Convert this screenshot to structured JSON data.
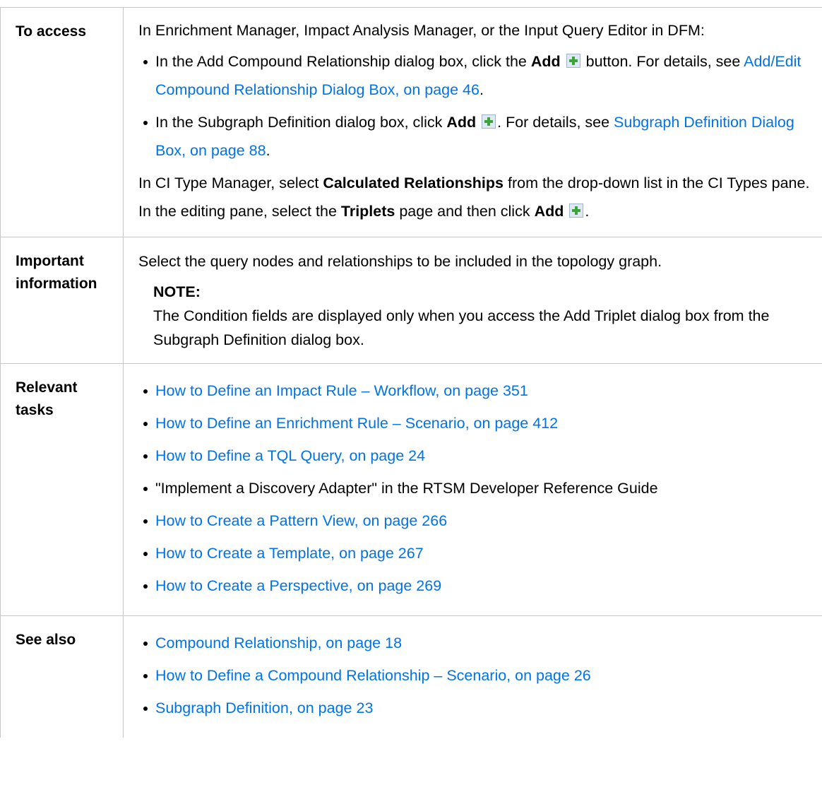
{
  "rows": {
    "access": {
      "label": "To access",
      "intro": "In Enrichment Manager, Impact Analysis Manager, or the Input Query Editor in DFM:",
      "bullet1": {
        "pre": "In the Add Compound Relationship dialog box, click the ",
        "bold": "Add",
        "mid": " button. For details, see ",
        "link": "Add/Edit Compound Relationship Dialog Box, on page 46",
        "post": "."
      },
      "bullet2": {
        "pre": "In the Subgraph Definition dialog box, click ",
        "bold": "Add",
        "mid": ". For details, see ",
        "link": "Subgraph Definition Dialog Box, on page 88",
        "post": "."
      },
      "closing": {
        "pre": "In CI Type Manager, select ",
        "bold1": "Calculated Relationships",
        "mid1": " from the drop-down list in the CI Types pane. In the editing pane, select the ",
        "bold2": "Triplets",
        "mid2": " page and then click ",
        "bold3": "Add",
        "post": "."
      }
    },
    "important": {
      "label": "Important information",
      "text": "Select the query nodes and relationships to be included in the topology graph.",
      "note_title": "NOTE:",
      "note_text": "The Condition fields are displayed only when you access the Add Triplet dialog box from the Subgraph Definition dialog box."
    },
    "relevant": {
      "label": "Relevant tasks",
      "items": [
        "How to Define an Impact Rule – Workflow, on page 351",
        "How to Define an Enrichment Rule – Scenario, on page 412",
        "How to Define a TQL Query, on page 24",
        "\"Implement a Discovery Adapter\" in the RTSM Developer Reference Guide",
        "How to Create a Pattern View, on page 266",
        "How to Create a Template, on page 267",
        "How to Create a Perspective, on page 269"
      ]
    },
    "see_also": {
      "label": "See also",
      "items": [
        "Compound Relationship, on page 18",
        "How to Define a Compound Relationship – Scenario, on page 26",
        "Subgraph Definition, on page 23"
      ]
    }
  },
  "icons": {
    "add": "add-plus-icon"
  },
  "colors": {
    "link": "#0073e7",
    "border": "#c6c6c6",
    "icon_green": "#3aa33a"
  }
}
